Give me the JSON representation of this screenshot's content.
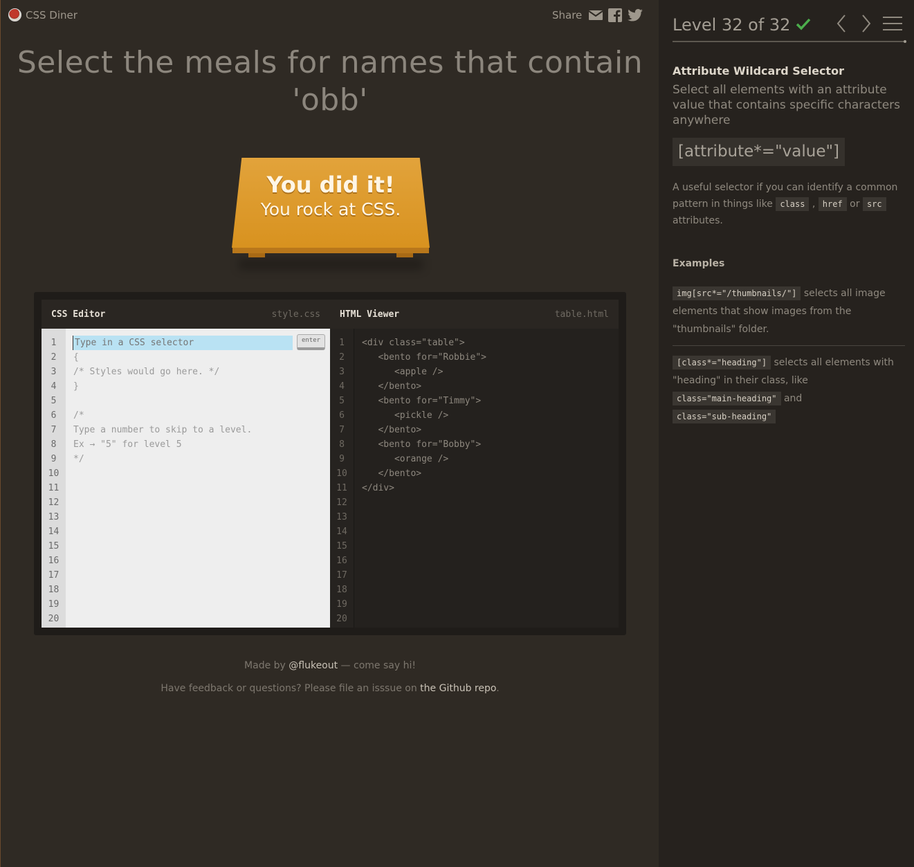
{
  "header": {
    "app_name": "CSS Diner",
    "share_label": "Share"
  },
  "order": {
    "line1": "Select the meals for names that contain",
    "line2": "'obb'"
  },
  "plate": {
    "line1": "You did it!",
    "line2": "You rock at CSS."
  },
  "editor": {
    "css_title": "CSS Editor",
    "css_file": "style.css",
    "html_title": "HTML Viewer",
    "html_file": "table.html",
    "input_placeholder": "Type in a CSS selector",
    "enter_label": "enter",
    "css_lines": [
      "",
      "{",
      "/* Styles would go here. */",
      "}",
      "",
      "/*",
      "Type a number to skip to a level.",
      "Ex → \"5\" for level 5",
      "*/"
    ],
    "html_lines": [
      "<div class=\"table\">",
      "   <bento for=\"Robbie\">",
      "      <apple />",
      "   </bento>",
      "   <bento for=\"Timmy\">",
      "      <pickle />",
      "   </bento>",
      "   <bento for=\"Bobby\">",
      "      <orange />",
      "   </bento>",
      "</div>"
    ],
    "line_numbers": [
      "1",
      "2",
      "3",
      "4",
      "5",
      "6",
      "7",
      "8",
      "9",
      "10",
      "11",
      "12",
      "13",
      "14",
      "15",
      "16",
      "17",
      "18",
      "19",
      "20"
    ]
  },
  "footer": {
    "made_by_prefix": "Made by ",
    "made_by_link": "@flukeout",
    "made_by_suffix": " — come say hi!",
    "feedback_prefix": "Have feedback or questions? Please file an isssue on ",
    "feedback_link": "the Github repo",
    "feedback_suffix": "."
  },
  "sidebar": {
    "level_label": "Level 32 of 32",
    "selector_name": "Attribute Wildcard Selector",
    "selector_desc": "Select all elements with an attribute value that contains specific characters anywhere",
    "syntax": "[attribute*=\"value\"]",
    "hint_prefix": "A useful selector if you can identify a common pattern in things like ",
    "hint_chip1": "class",
    "hint_sep1": " , ",
    "hint_chip2": "href",
    "hint_sep2": " or ",
    "hint_chip3": "src",
    "hint_suffix": " attributes.",
    "examples_title": "Examples",
    "example1_code": "img[src*=\"/thumbnails/\"]",
    "example1_text": " selects all image elements that show images from the \"thumbnails\" folder.",
    "example2_code": "[class*=\"heading\"]",
    "example2_text_a": " selects all elements with \"heading\" in their class, like ",
    "example2_code2": "class=\"main-heading\"",
    "example2_text_b": " and ",
    "example2_code3": "class=\"sub-heading\""
  },
  "colors": {
    "accent_orange": "#e09a2c",
    "check_green": "#4cae4c",
    "input_highlight": "#b9e2f3"
  }
}
